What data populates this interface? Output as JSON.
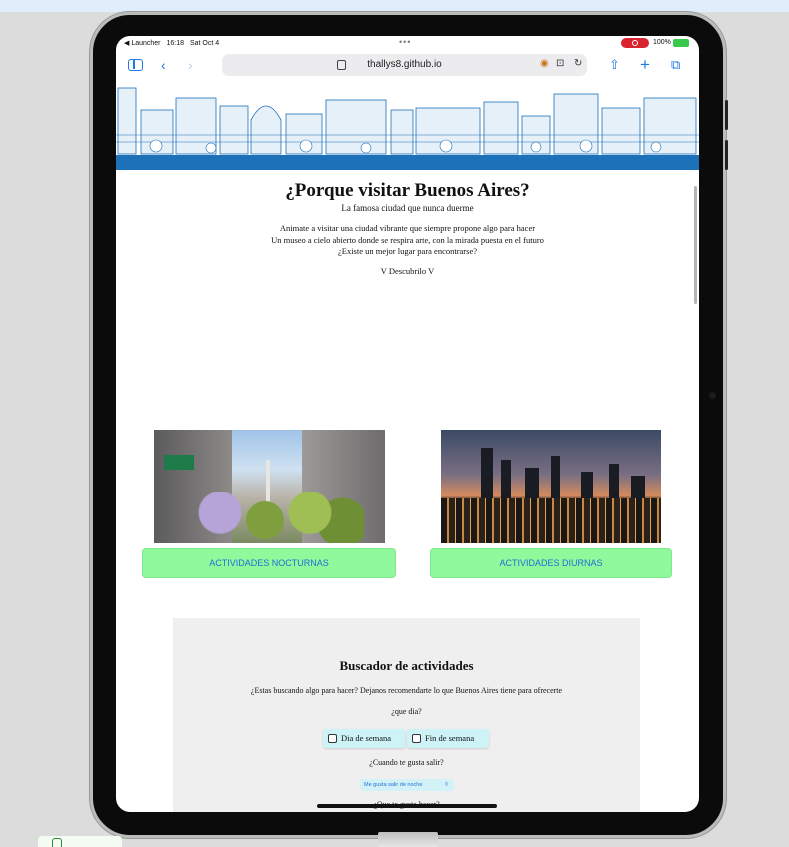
{
  "status_bar": {
    "back_app": "◀ Launcher",
    "time": "16:18",
    "date": "Sat Oct 4",
    "battery": "100%"
  },
  "browser": {
    "url": "thallys8.github.io"
  },
  "hero": {
    "title": "¿Porque visitar Buenos Aires?",
    "subtitle": "La famosa ciudad que nunca duerme",
    "paragraph_lines": [
      "Animate a visitar una ciudad vibrante que siempre propone algo para hacer",
      "Un museo a cielo abierto donde se respira arte, con la mirada puesta en el futuro",
      "¿Existe un mejor lugar para encontrarse?"
    ],
    "discover": "V Descubrilo V"
  },
  "activities": {
    "night_label": "ACTIVIDADES NOCTURNAS",
    "day_label": "ACTIVIDADES DIURNAS"
  },
  "search": {
    "title": "Buscador de actividades",
    "description": "¿Estas buscando algo para hacer? Dejanos recomendarte lo que Buenos Aires tiene para ofrecerte",
    "question_day": "¿que dia?",
    "option_weekday": "Dia de semana",
    "option_weekend": "Fin de semana",
    "question_when": "¿Cuando te gusta salir?",
    "when_selected": "Me gusta salir de noche",
    "question_what": "¿Que te gusta hacer?"
  },
  "colors": {
    "button_green": "#8ff99c",
    "button_text": "#1f6fd6",
    "banner_blue": "#1d71b8",
    "checkbox_bg": "#cdf3f7"
  }
}
